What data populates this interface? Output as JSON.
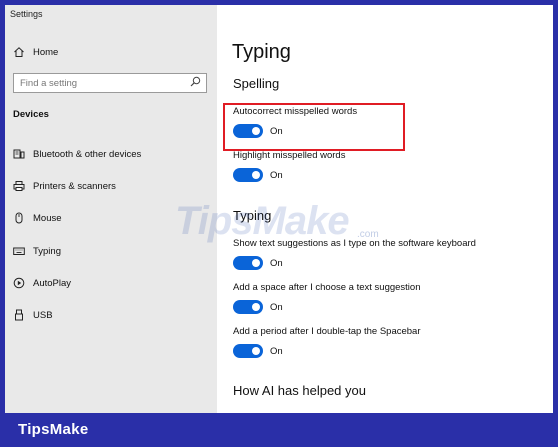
{
  "window": {
    "title": "Settings"
  },
  "sidebar": {
    "home_label": "Home",
    "search_placeholder": "Find a setting",
    "section_title": "Devices",
    "items": [
      {
        "label": "Bluetooth & other devices",
        "icon": "bluetooth-devices-icon"
      },
      {
        "label": "Printers & scanners",
        "icon": "printer-icon"
      },
      {
        "label": "Mouse",
        "icon": "mouse-icon"
      },
      {
        "label": "Typing",
        "icon": "keyboard-icon"
      },
      {
        "label": "AutoPlay",
        "icon": "autoplay-icon"
      },
      {
        "label": "USB",
        "icon": "usb-icon"
      }
    ]
  },
  "main": {
    "title": "Typing",
    "spelling": {
      "heading": "Spelling",
      "autocorrect": {
        "label": "Autocorrect misspelled words",
        "state": "On"
      },
      "highlight": {
        "label": "Highlight misspelled words",
        "state": "On"
      }
    },
    "typing": {
      "heading": "Typing",
      "suggestions": {
        "label": "Show text suggestions as I type on the software keyboard",
        "state": "On"
      },
      "space": {
        "label": "Add a space after I choose a text suggestion",
        "state": "On"
      },
      "period": {
        "label": "Add a period after I double-tap the Spacebar",
        "state": "On"
      }
    },
    "ai_heading": "How AI has helped you"
  },
  "watermark": {
    "text": "TipsMake",
    "suffix": ".com"
  },
  "footer": {
    "brand": "TipsMake"
  },
  "colors": {
    "accent": "#0a64d8",
    "highlight": "#e01c24",
    "frame": "#2a2fa8",
    "sidebar": "#e9e9e9"
  }
}
